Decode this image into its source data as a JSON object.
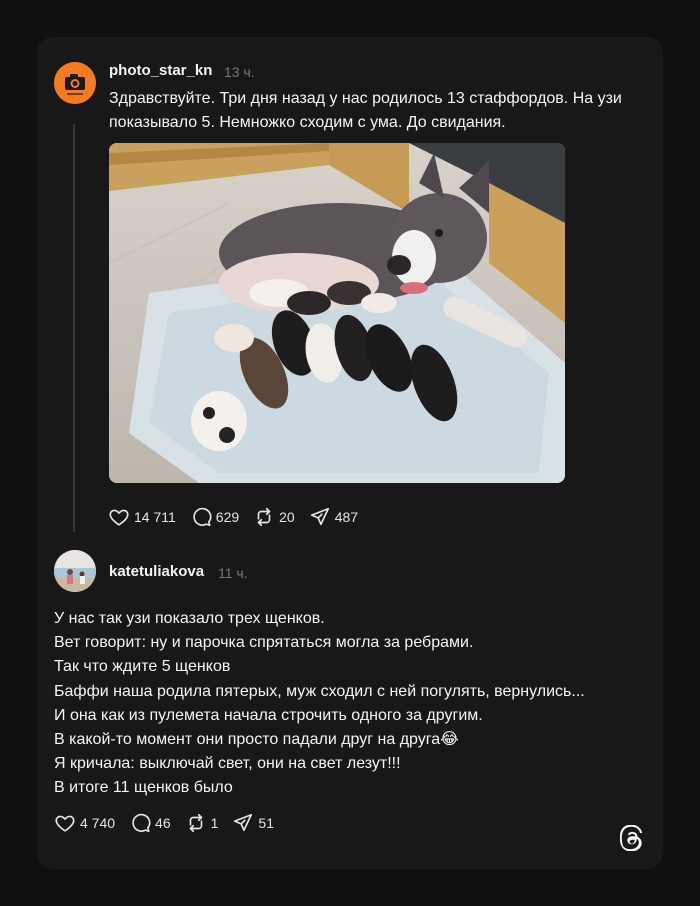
{
  "post": {
    "username": "photo_star_kn",
    "time": "13 ч.",
    "text": "Здравствуйте. Три дня назад у нас родилось 13 стаффордов. На узи показывало 5. Немножко сходим с ума. До свидания.",
    "likes": "14 711",
    "comments": "629",
    "reposts": "20",
    "shares": "487"
  },
  "reply": {
    "username": "katetuliakova",
    "time": "11 ч.",
    "lines": [
      "У нас так узи показало трех щенков.",
      "Вет говорит: ну и парочка спрятаться могла за ребрами.",
      "Так что ждите 5 щенков",
      "Баффи наша родила пятерых, муж сходил с ней погулять, вернулись...",
      "И она как из пулемета начала строчить одного за другим.",
      "В какой-то момент они просто падали друг на друга",
      "Я кричала: выключай свет, они на свет лезут!!!",
      "В итоге 11 щенков было"
    ],
    "emoji": "😂",
    "likes": "4 740",
    "comments": "46",
    "reposts": "1",
    "shares": "51"
  },
  "icons": {
    "like": "heart-icon",
    "comment": "comment-bubble-icon",
    "repost": "repost-icon",
    "share": "share-icon",
    "brand": "threads-logo-icon"
  },
  "colors": {
    "background": "#101010",
    "card": "#181818",
    "text": "#f3f5f7",
    "muted": "#777777",
    "avatar_orange": "#f47c20"
  }
}
